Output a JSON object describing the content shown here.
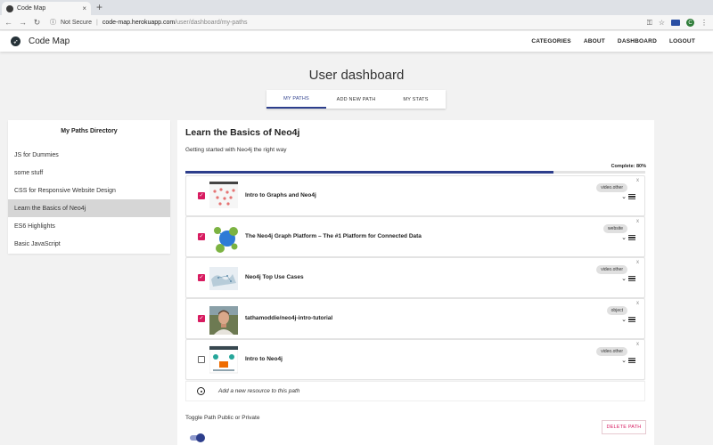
{
  "browser": {
    "tab_title": "Code Map",
    "tab_close": "×",
    "new_tab": "+",
    "security": "Not Secure",
    "url_host": "code-map.herokuapp.com",
    "url_path": "/user/dashboard/my-paths",
    "profile_initial": "C"
  },
  "app": {
    "brand": "Code Map",
    "nav": [
      "CATEGORIES",
      "ABOUT",
      "DASHBOARD",
      "LOGOUT"
    ]
  },
  "page": {
    "title": "User dashboard",
    "tabs": [
      "MY PATHS",
      "ADD NEW PATH",
      "MY STATS"
    ],
    "active_tab": "MY PATHS"
  },
  "sidebar": {
    "heading": "My Paths Directory",
    "items": [
      "JS for Dummies",
      "some stuff",
      "CSS for Responsive Website Design",
      "Learn the Basics of Neo4j",
      "ES6 Highlights",
      "Basic JavaScript"
    ],
    "selected_index": 3
  },
  "path": {
    "title": "Learn the Basics of Neo4j",
    "description": "Getting started with Neo4j the right way",
    "complete_label": "Complete: 80%",
    "progress_fraction": 0.8,
    "resources": [
      {
        "title": "Intro to Graphs and Neo4j",
        "type": "video.other",
        "checked": true,
        "thumb": "graph-dots"
      },
      {
        "title": "The Neo4j Graph Platform – The #1 Platform for Connected Data",
        "type": "website",
        "checked": true,
        "thumb": "neo4j-logo"
      },
      {
        "title": "Neo4j Top Use Cases",
        "type": "video.other",
        "checked": true,
        "thumb": "map"
      },
      {
        "title": "tathamoddie/neo4j-intro-tutorial",
        "type": "object",
        "checked": true,
        "thumb": "person"
      },
      {
        "title": "Intro to Neo4j",
        "type": "video.other",
        "checked": false,
        "thumb": "slides"
      }
    ],
    "add_resource": "Add a new resource to this path",
    "toggle_label": "Toggle Path Public or Private",
    "toggle_on": true,
    "delete_label": "DELETE PATH",
    "remove_glyph": "x"
  },
  "colors": {
    "accent": "#2d3e8c",
    "danger": "#d81b60"
  }
}
